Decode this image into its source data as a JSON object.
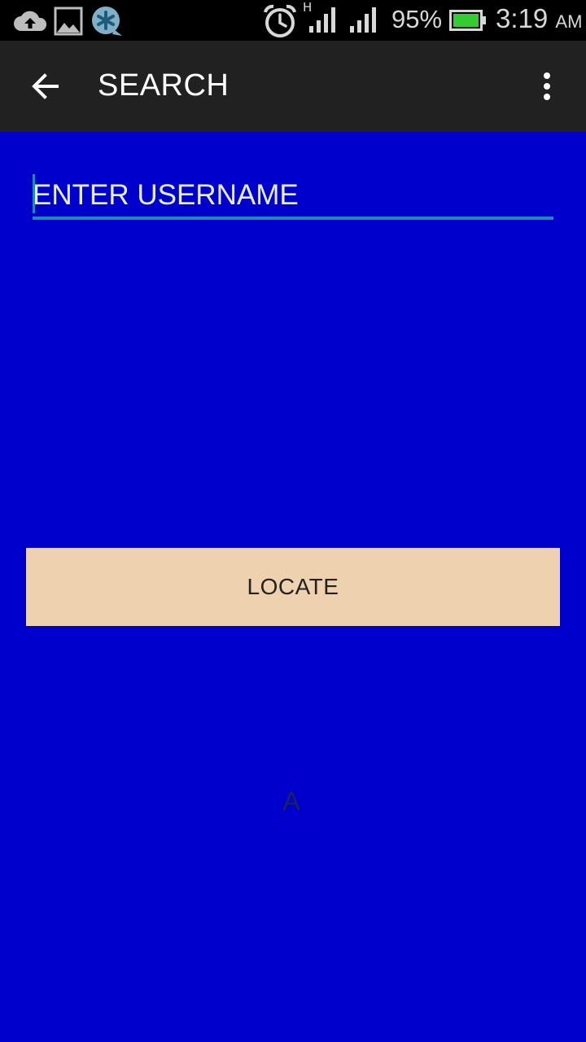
{
  "status_bar": {
    "network_type": "H",
    "battery_percent": "95%",
    "time": "3:19",
    "ampm": "AM",
    "icons": [
      "cloud-upload-icon",
      "gallery-icon",
      "app-notification-icon",
      "alarm-icon",
      "signal-icon",
      "signal-icon",
      "battery-icon"
    ],
    "battery_color": "#33CC33"
  },
  "toolbar": {
    "title": "SEARCH",
    "back_icon": "arrow-back-icon",
    "menu_icon": "overflow-menu-icon",
    "background": "#212121"
  },
  "form": {
    "username_placeholder": "ENTER USERNAME",
    "username_value": "",
    "underline_color": "#1E88B7"
  },
  "actions": {
    "locate_label": "LOCATE",
    "locate_color": "#EED1AF"
  },
  "result": {
    "text": "A"
  },
  "theme": {
    "background": "#0000CD"
  }
}
